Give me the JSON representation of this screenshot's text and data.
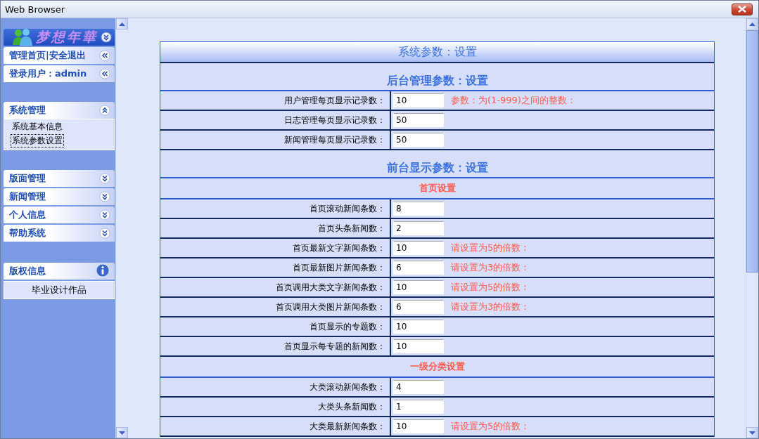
{
  "window": {
    "title": "Web Browser"
  },
  "sidebar": {
    "logo": "梦想年華",
    "top_links": [
      {
        "label": "管理首页|安全退出"
      },
      {
        "label": "登录用户：admin"
      }
    ],
    "menu_groups": [
      {
        "menus": [
          {
            "title": "系统管理",
            "expanded": true,
            "items": [
              {
                "label": "系统基本信息",
                "selected": false
              },
              {
                "label": "系统参数设置",
                "selected": true
              }
            ]
          }
        ]
      },
      {
        "menus": [
          {
            "title": "版面管理",
            "expanded": false
          },
          {
            "title": "新闻管理",
            "expanded": false
          },
          {
            "title": "个人信息",
            "expanded": false
          },
          {
            "title": "帮助系统",
            "expanded": false
          }
        ]
      }
    ],
    "copyright": {
      "title": "版权信息",
      "text": "毕业设计作品"
    }
  },
  "form": {
    "title": "系统参数：设置",
    "rows": [
      {
        "kind": "heading",
        "text": "后台管理参数：设置"
      },
      {
        "kind": "field",
        "label": "用户管理每页显示记录数：",
        "value": "10",
        "hint": "参数：为(1-999)之间的整数："
      },
      {
        "kind": "field",
        "label": "日志管理每页显示记录数：",
        "value": "50"
      },
      {
        "kind": "field",
        "label": "新闻管理每页显示记录数：",
        "value": "50"
      },
      {
        "kind": "heading",
        "text": "前台显示参数：设置"
      },
      {
        "kind": "subheading",
        "text": "首页设置"
      },
      {
        "kind": "field",
        "label": "首页滚动新闻条数：",
        "value": "8"
      },
      {
        "kind": "field",
        "label": "首页头条新闻数：",
        "value": "2"
      },
      {
        "kind": "field",
        "label": "首页最新文字新闻条数：",
        "value": "10",
        "hint": "请设置为5的倍数："
      },
      {
        "kind": "field",
        "label": "首页最新图片新闻条数：",
        "value": "6",
        "hint": "请设置为3的倍数："
      },
      {
        "kind": "field",
        "label": "首页调用大类文字新闻条数：",
        "value": "10",
        "hint": "请设置为5的倍数："
      },
      {
        "kind": "field",
        "label": "首页调用大类图片新闻条数：",
        "value": "6",
        "hint": "请设置为3的倍数："
      },
      {
        "kind": "field",
        "label": "首页显示的专题数：",
        "value": "10"
      },
      {
        "kind": "field",
        "label": "首页显示每专题的新闻数：",
        "value": "10"
      },
      {
        "kind": "subheading",
        "text": "一级分类设置"
      },
      {
        "kind": "field",
        "label": "大类滚动新闻条数：",
        "value": "4"
      },
      {
        "kind": "field",
        "label": "大类头条新闻数：",
        "value": "1"
      },
      {
        "kind": "field",
        "label": "大类最新新闻条数：",
        "value": "10",
        "hint": "请设置为5的倍数："
      }
    ]
  }
}
